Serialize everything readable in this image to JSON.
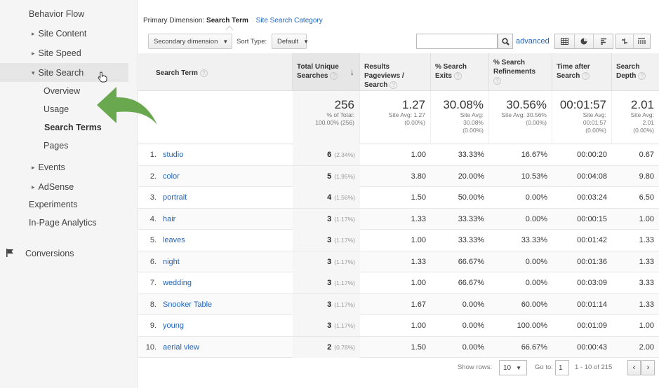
{
  "sidebar": {
    "items": [
      {
        "label": "Behavior Flow"
      },
      {
        "label": "Site Content"
      },
      {
        "label": "Site Speed"
      },
      {
        "label": "Site Search"
      },
      {
        "label": "Overview"
      },
      {
        "label": "Usage"
      },
      {
        "label": "Search Terms"
      },
      {
        "label": "Pages"
      },
      {
        "label": "Events"
      },
      {
        "label": "AdSense"
      },
      {
        "label": "Experiments"
      },
      {
        "label": "In-Page Analytics"
      },
      {
        "label": "Conversions"
      }
    ]
  },
  "primary_dimension": {
    "label": "Primary Dimension:",
    "active": "Search Term",
    "other": "Site Search Category"
  },
  "controls": {
    "secondary_dimension": "Secondary dimension",
    "sort_type_label": "Sort Type:",
    "sort_type_value": "Default",
    "search_placeholder": "",
    "advanced_label": "advanced"
  },
  "table": {
    "headers": {
      "term": "Search Term",
      "total_unique_searches": "Total Unique Searches",
      "results_pageviews": "Results Pageviews / Search",
      "search_exits": "% Search Exits",
      "search_refinements": "% Search Refinements",
      "time_after_search": "Time after Search",
      "search_depth": "Search Depth"
    },
    "totals": {
      "total_unique_searches": {
        "value": "256",
        "sub1": "% of Total:",
        "sub2": "100.00% (256)"
      },
      "results_pageviews": {
        "value": "1.27",
        "sub1": "Site Avg: 1.27",
        "sub2": "(0.00%)"
      },
      "search_exits": {
        "value": "30.08%",
        "sub1": "Site Avg:",
        "sub2": "30.08%",
        "sub3": "(0.00%)"
      },
      "search_refinements": {
        "value": "30.56%",
        "sub1": "Site Avg: 30.56%",
        "sub2": "(0.00%)"
      },
      "time_after_search": {
        "value": "00:01:57",
        "sub1": "Site Avg:",
        "sub2": "00:01:57",
        "sub3": "(0.00%)"
      },
      "search_depth": {
        "value": "2.01",
        "sub1": "Site Avg:",
        "sub2": "2.01",
        "sub3": "(0.00%)"
      }
    },
    "rows": [
      {
        "num": "1.",
        "term": "studio",
        "unique": "6",
        "pct": "(2.34%)",
        "rpv": "1.00",
        "exits": "33.33%",
        "refine": "16.67%",
        "time": "00:00:20",
        "depth": "0.67"
      },
      {
        "num": "2.",
        "term": "color",
        "unique": "5",
        "pct": "(1.95%)",
        "rpv": "3.80",
        "exits": "20.00%",
        "refine": "10.53%",
        "time": "00:04:08",
        "depth": "9.80"
      },
      {
        "num": "3.",
        "term": "portrait",
        "unique": "4",
        "pct": "(1.56%)",
        "rpv": "1.50",
        "exits": "50.00%",
        "refine": "0.00%",
        "time": "00:03:24",
        "depth": "6.50"
      },
      {
        "num": "4.",
        "term": "hair",
        "unique": "3",
        "pct": "(1.17%)",
        "rpv": "1.33",
        "exits": "33.33%",
        "refine": "0.00%",
        "time": "00:00:15",
        "depth": "1.00"
      },
      {
        "num": "5.",
        "term": "leaves",
        "unique": "3",
        "pct": "(1.17%)",
        "rpv": "1.00",
        "exits": "33.33%",
        "refine": "33.33%",
        "time": "00:01:42",
        "depth": "1.33"
      },
      {
        "num": "6.",
        "term": "night",
        "unique": "3",
        "pct": "(1.17%)",
        "rpv": "1.33",
        "exits": "66.67%",
        "refine": "0.00%",
        "time": "00:01:36",
        "depth": "1.33"
      },
      {
        "num": "7.",
        "term": "wedding",
        "unique": "3",
        "pct": "(1.17%)",
        "rpv": "1.00",
        "exits": "66.67%",
        "refine": "0.00%",
        "time": "00:03:09",
        "depth": "3.33"
      },
      {
        "num": "8.",
        "term": "Snooker Table",
        "unique": "3",
        "pct": "(1.17%)",
        "rpv": "1.67",
        "exits": "0.00%",
        "refine": "60.00%",
        "time": "00:01:14",
        "depth": "1.33"
      },
      {
        "num": "9.",
        "term": "young",
        "unique": "3",
        "pct": "(1.17%)",
        "rpv": "1.00",
        "exits": "0.00%",
        "refine": "100.00%",
        "time": "00:01:09",
        "depth": "1.00"
      },
      {
        "num": "10.",
        "term": "aerial view",
        "unique": "2",
        "pct": "(0.78%)",
        "rpv": "1.50",
        "exits": "0.00%",
        "refine": "66.67%",
        "time": "00:00:43",
        "depth": "2.00"
      }
    ]
  },
  "footer": {
    "show_rows_label": "Show rows:",
    "show_rows_value": "10",
    "goto_label": "Go to:",
    "goto_value": "1",
    "range": "1 - 10 of 215"
  },
  "colors": {
    "link": "#2266bb",
    "arrow": "#6aa84f",
    "sidebar_bg": "#f5f5f5"
  }
}
